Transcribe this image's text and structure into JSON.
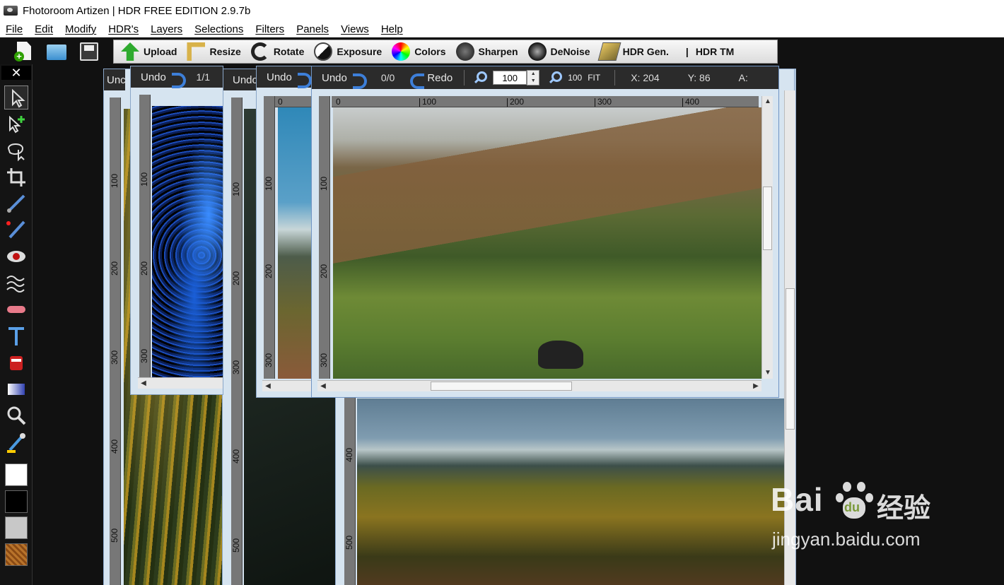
{
  "window": {
    "title": "Fhotoroom Artizen | HDR FREE EDITION 2.9.7b"
  },
  "menu": [
    "File",
    "Edit",
    "Modify",
    "HDR's",
    "Layers",
    "Selections",
    "Filters",
    "Panels",
    "Views",
    "Help"
  ],
  "toolbar": {
    "upload": "Upload",
    "resize": "Resize",
    "rotate": "Rotate",
    "exposure": "Exposure",
    "colors": "Colors",
    "sharpen": "Sharpen",
    "denoise": "DeNoise",
    "hdr_gen": "HDR Gen.",
    "separator": "|",
    "hdr_tm": "HDR TM"
  },
  "tools_panel": {
    "close": "✕"
  },
  "swatches": {
    "colors": [
      "#ffffff",
      "#000000",
      "#c8c8c8",
      "#b8732a"
    ]
  },
  "doc_windows": {
    "back1": {
      "undo": "Unc"
    },
    "back2": {
      "undo": "Undo",
      "counter": "1/1"
    },
    "back3": {
      "undo": "Undo"
    },
    "back4": {
      "undo": "Undo"
    },
    "front": {
      "undo": "Undo",
      "counter": "0/0",
      "redo": "Redo",
      "zoom_value": "100",
      "zoom_100": "100",
      "fit": "FIT",
      "x_label": "X: 204",
      "y_label": "Y: 86",
      "a_label": "A:"
    }
  },
  "rulers": {
    "front_h": [
      "0",
      "100",
      "200",
      "300",
      "400"
    ],
    "front_v": [
      "100",
      "200",
      "300"
    ],
    "back_v": [
      "100",
      "200",
      "300",
      "400",
      "500"
    ],
    "back_h_zero": "0"
  },
  "watermark": {
    "logo": "Bai",
    "logo2": "du",
    "cn": "经验",
    "url": "jingyan.baidu.com"
  }
}
